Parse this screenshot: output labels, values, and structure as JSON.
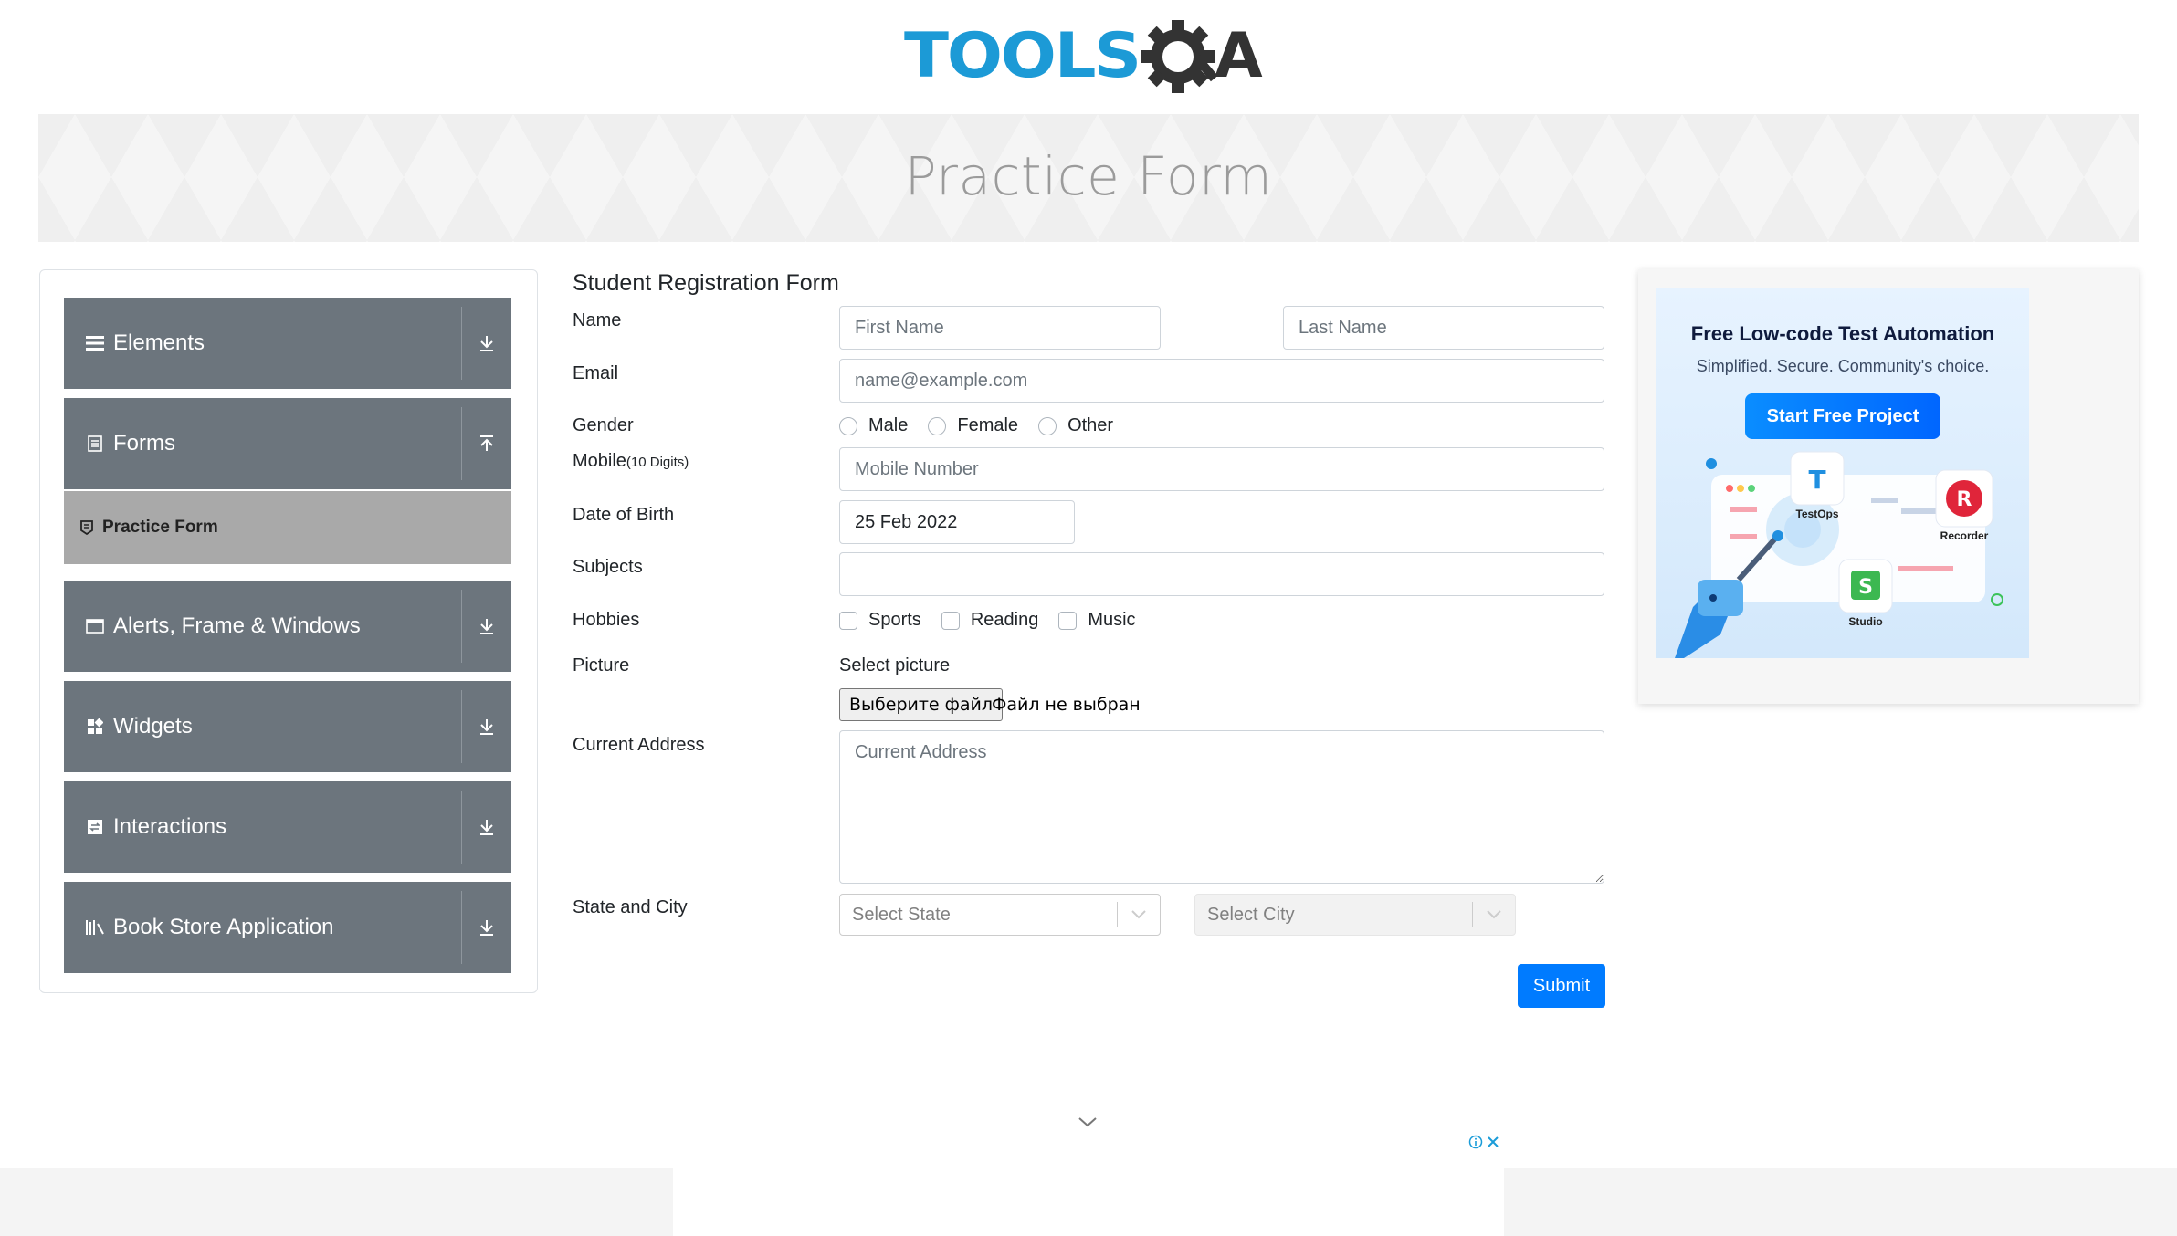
{
  "header": {
    "logo_text": "TOOLSQA",
    "banner_title": "Practice Form"
  },
  "sidebar": {
    "groups": [
      {
        "label": "Elements",
        "icon": "menu-icon",
        "arrow": "download-arrow-icon"
      },
      {
        "label": "Forms",
        "icon": "form-doc-icon",
        "arrow": "upload-arrow-icon"
      },
      {
        "label": "Alerts, Frame & Windows",
        "icon": "window-icon",
        "arrow": "download-arrow-icon"
      },
      {
        "label": "Widgets",
        "icon": "widgets-grid-icon",
        "arrow": "download-arrow-icon"
      },
      {
        "label": "Interactions",
        "icon": "interactions-icon",
        "arrow": "download-arrow-icon"
      },
      {
        "label": "Book Store Application",
        "icon": "library-icon",
        "arrow": "download-arrow-icon"
      }
    ],
    "active_item": {
      "label": "Practice Form",
      "icon": "form-small-icon"
    }
  },
  "form": {
    "heading": "Student Registration Form",
    "name_label": "Name",
    "first_name_placeholder": "First Name",
    "last_name_placeholder": "Last Name",
    "email_label": "Email",
    "email_placeholder": "name@example.com",
    "gender_label": "Gender",
    "gender_options": [
      "Male",
      "Female",
      "Other"
    ],
    "mobile_label": "Mobile",
    "mobile_hint": "(10 Digits)",
    "mobile_placeholder": "Mobile Number",
    "dob_label": "Date of Birth",
    "dob_value": "25 Feb 2022",
    "subjects_label": "Subjects",
    "hobbies_label": "Hobbies",
    "hobbies_options": [
      "Sports",
      "Reading",
      "Music"
    ],
    "picture_label": "Picture",
    "picture_caption": "Select picture",
    "file_button": "Выберите файл",
    "file_status": "Файл не выбран",
    "address_label": "Current Address",
    "address_placeholder": "Current Address",
    "state_city_label": "State and City",
    "state_placeholder": "Select State",
    "city_placeholder": "Select City",
    "submit_label": "Submit"
  },
  "ad": {
    "title": "Free Low-code Test Automation",
    "subtitle": "Simplified. Secure. Community's choice.",
    "button": "Start Free Project",
    "products": [
      "TestOps",
      "Recorder",
      "Studio"
    ]
  },
  "colors": {
    "sidebar_header": "#6c757d",
    "sidebar_active": "#a9a9a9",
    "primary": "#007bff",
    "logo_blue": "#1c9ad6",
    "logo_dark": "#333333"
  }
}
